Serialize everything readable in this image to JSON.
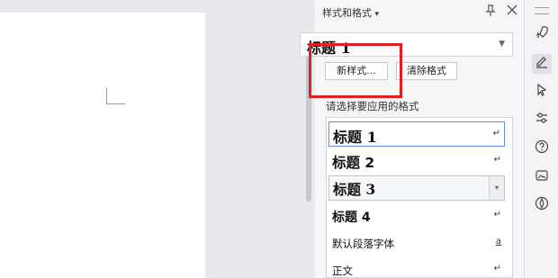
{
  "panel": {
    "title": "样式和格式",
    "title_arrow": "▾",
    "pin_icon": "pin-icon",
    "close_icon": "close-icon",
    "current_style": "标题 1",
    "new_style_label": "新样式...",
    "clear_format_label": "清除格式",
    "choose_label": "请选择要应用的格式",
    "styles": [
      {
        "label": "标题 1",
        "mark": "↵"
      },
      {
        "label": "标题 2",
        "mark": "↵"
      },
      {
        "label": "标题 3",
        "mark": "▾"
      },
      {
        "label": "标题 4",
        "mark": "↵"
      },
      {
        "label": "默认段落字体",
        "mark": "a"
      },
      {
        "label": "正文",
        "mark": "↵"
      }
    ]
  },
  "sidebar": {
    "icons": [
      "rocket-icon",
      "pen-icon",
      "cursor-icon",
      "sliders-icon",
      "help-icon",
      "image-edit-icon",
      "compass-icon"
    ]
  },
  "colors": {
    "highlight_box": "#e02020",
    "selected_border": "#5b8fd9"
  }
}
